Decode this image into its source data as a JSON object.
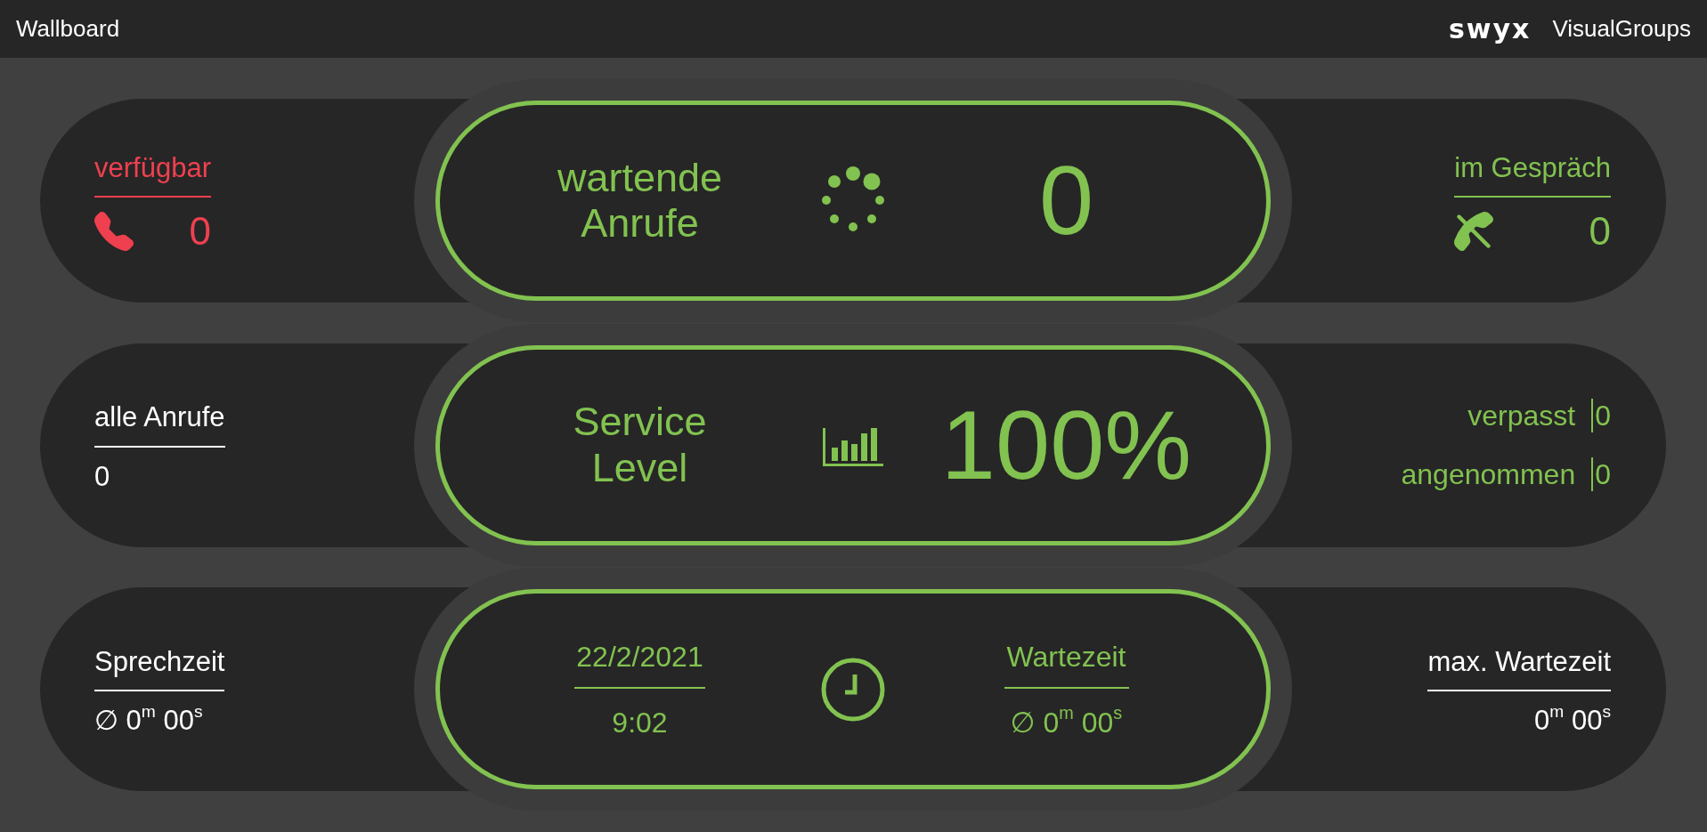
{
  "header": {
    "title": "Wallboard",
    "logo": "swyx",
    "app_name": "VisualGroups"
  },
  "rows": [
    {
      "left": {
        "kind": "phone",
        "label": "verfügbar",
        "value": "0",
        "color": "#ef4050"
      },
      "center": {
        "kind": "spinner",
        "label": "wartende Anrufe",
        "value": "0"
      },
      "right": {
        "kind": "phone-busy",
        "label": "im Gespräch",
        "value": "0",
        "color": "#82c250"
      }
    },
    {
      "left": {
        "kind": "plain",
        "label": "alle Anrufe",
        "value": "0",
        "color": "#ffffff"
      },
      "center": {
        "kind": "chart",
        "label": "Service Level",
        "value": "100%"
      },
      "right": {
        "kind": "pairs",
        "color": "#82c250",
        "items": [
          {
            "label": "verpasst",
            "value": "0"
          },
          {
            "label": "angenommen",
            "value": "0"
          }
        ]
      }
    },
    {
      "left": {
        "kind": "plain",
        "label": "Sprechzeit",
        "value": "∅ 0$^{m}$ 00$^{s}$",
        "color": "#ffffff"
      },
      "center": {
        "kind": "datetime",
        "date": "22/2/2021",
        "time": "9:02",
        "label": "Wartezeit",
        "value": "∅ 0$^{m}$ 00$^{s}$"
      },
      "right": {
        "kind": "plain",
        "label": "max. Wartezeit",
        "value": "0$^{m}$ 00$^{s}$",
        "color": "#ffffff"
      }
    }
  ]
}
